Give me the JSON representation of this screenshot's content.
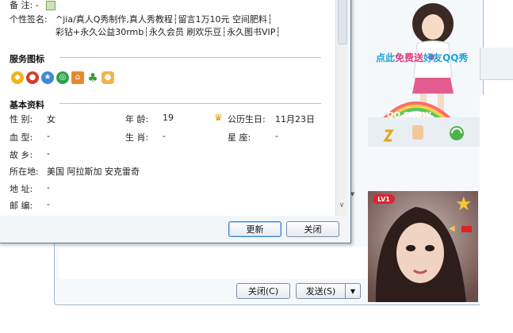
{
  "dialog": {
    "remark": {
      "label": "备    注:",
      "value": "-"
    },
    "signature": {
      "label": "个性签名:",
      "line1": "^jia/真人Q秀制作,真人秀教程┆留言1万10元 空间肥料┆",
      "line2": "彩钻+永久公益30rmb┆永久会员 刷欢乐豆┆永久图书VIP┆"
    },
    "services_title": "服务图标",
    "service_icons": [
      "vip-shield-icon",
      "qq-penguin-icon",
      "qq-game-icon",
      "qq-pet-icon",
      "qzone-icon",
      "clover-icon",
      "qq-pet-cat-icon"
    ],
    "basic_title": "基本资料",
    "fields": {
      "gender": {
        "label": "性    别:",
        "value": "女"
      },
      "age": {
        "label": "年    龄:",
        "value": "19"
      },
      "birthday": {
        "label": "公历生日:",
        "value": "11月23日"
      },
      "blood": {
        "label": "血    型:",
        "value": "-"
      },
      "zodiac": {
        "label": "生    肖:",
        "value": "-"
      },
      "constellation": {
        "label": "星        座:",
        "value": "-"
      },
      "hometown": {
        "label": "故    乡:",
        "value": "-"
      },
      "location": {
        "label": "所在地:",
        "value": "美国 阿拉斯加 安克雷奇"
      },
      "address": {
        "label": "地    址:",
        "value": "-"
      },
      "zip": {
        "label": "邮    编:",
        "value": "-"
      }
    },
    "buttons": {
      "update": "更新",
      "close": "关闭"
    }
  },
  "chat": {
    "close_label": "关闭(C)",
    "send_label": "发送(S)",
    "send_arrow": "▼"
  },
  "ads": {
    "qqshow_text_a": "点此",
    "qqshow_text_b": "免费送",
    "qqshow_text_c": "好友QQ秀",
    "qqshow_logo": "QQ SHOW",
    "lv_badge": "LV1"
  },
  "colors": {
    "accent": "#3b7fc4",
    "section_line": "#a9c4e4",
    "ad_blue": "#1ea2d6",
    "ad_pink": "#e43a7a"
  }
}
